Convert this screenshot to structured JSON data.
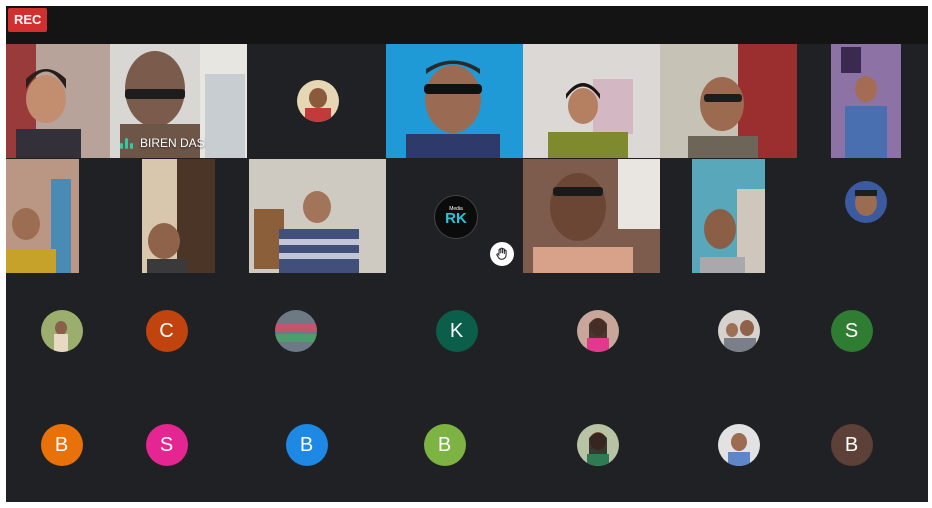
{
  "recording": {
    "label": "REC",
    "color": "#d32f2f"
  },
  "active_speaker": {
    "name": "BIREN DAS",
    "indicator_color": "#34c9a1"
  },
  "hand_raised_icon": "hand-raised-icon",
  "video_tiles": [
    {
      "id": "v1",
      "kind": "camera"
    },
    {
      "id": "v2",
      "kind": "camera",
      "speaking": true
    },
    {
      "id": "v3",
      "kind": "photo-avatar"
    },
    {
      "id": "v4",
      "kind": "camera"
    },
    {
      "id": "v5",
      "kind": "camera"
    },
    {
      "id": "v6",
      "kind": "camera"
    },
    {
      "id": "v7",
      "kind": "camera"
    },
    {
      "id": "v8",
      "kind": "camera"
    },
    {
      "id": "v9",
      "kind": "camera"
    },
    {
      "id": "v10",
      "kind": "camera"
    },
    {
      "id": "v11",
      "kind": "logo-avatar",
      "hand_raised": true
    },
    {
      "id": "v12",
      "kind": "camera"
    },
    {
      "id": "v13",
      "kind": "camera"
    },
    {
      "id": "v14",
      "kind": "photo-avatar"
    }
  ],
  "letter_avatars": [
    {
      "letter": "C",
      "color": "#c1440e"
    },
    {
      "letter": "K",
      "color": "#0b5e4a"
    },
    {
      "letter": "S",
      "color": "#2e7d32"
    },
    {
      "letter": "B",
      "color": "#e8710a"
    },
    {
      "letter": "S",
      "color": "#e52592"
    },
    {
      "letter": "B",
      "color": "#1e88e5"
    },
    {
      "letter": "B",
      "color": "#7cb342"
    },
    {
      "letter": "B",
      "color": "#5d4037"
    }
  ]
}
